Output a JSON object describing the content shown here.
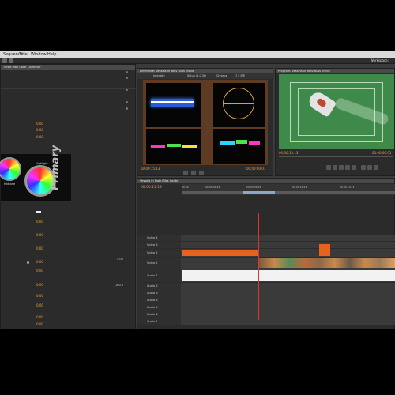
{
  "menu": {
    "sequence": "Sequence",
    "title": "Title",
    "window": "Window",
    "help": "Help"
  },
  "workspace_label": "Workspace:",
  "left_panel": {
    "title": "Three-Way Color Corrector",
    "values": [
      "0.00",
      "0.00",
      "0.00",
      "0.00",
      "0.00",
      "0.00",
      "0.00",
      "0.00",
      "0.00",
      "0.00",
      "0.00",
      "0.00",
      "0.00"
    ],
    "right_values": [
      "4.00",
      "100.0"
    ],
    "wheel_labels": {
      "highlight": "Highlight",
      "midtone": "Midtone",
      "primary": "Primary"
    }
  },
  "scopes_panel": {
    "title": "Reference: Vessels in Yadv Bliss Inside",
    "toolbar": [
      "Intensity",
      "Setup (1.0.36)",
      "Chroma",
      "7.5 IRE"
    ],
    "timecode_left": "00:00:15:13",
    "timecode_right": "00:00:00:01"
  },
  "program_panel": {
    "title": "Program: Vessels in Yadv Bliss Inside",
    "timecode_left": "00:00:15:13",
    "timecode_right": "00:00:00:01"
  },
  "timeline": {
    "title": "Vessels in Yadv Bliss Inside",
    "timecode": "00:00:15:13",
    "tracks": [
      "Video 4",
      "Video 3",
      "Video 2",
      "Video 1",
      "Audio 1",
      "Audio 2",
      "Audio 3",
      "Audio 4",
      "Audio 5",
      "Audio 6"
    ],
    "ruler": [
      "00:00",
      "00:00:04:23",
      "00:00:09:23",
      "00:00:14:23",
      "00:00:19:23"
    ]
  }
}
